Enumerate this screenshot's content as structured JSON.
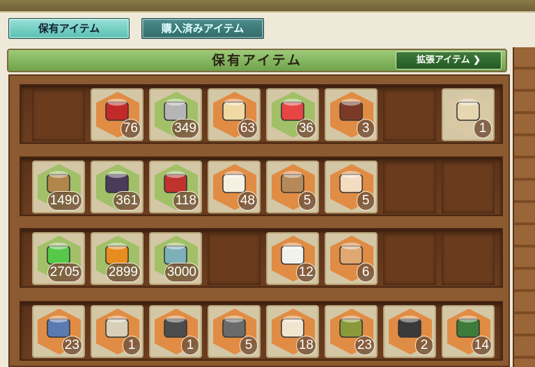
{
  "tabs": [
    {
      "label": "保有アイテム",
      "active": true
    },
    {
      "label": "購入済みアイテム",
      "active": false
    }
  ],
  "header": {
    "title": "保有アイテム",
    "expand_label": "拡張アイテム ❯"
  },
  "colors": {
    "hex_orange": "#e2853a",
    "hex_green": "#9bbf62",
    "hex_tan": "#d8c9a4"
  },
  "shelves": [
    {
      "slots": [
        null,
        {
          "icon": "red-box-medal-icon",
          "count": "76",
          "hex": "orange"
        },
        {
          "icon": "screw-icon",
          "count": "349",
          "hex": "green"
        },
        {
          "icon": "rice-ball-bento-icon",
          "count": "63",
          "hex": "orange"
        },
        {
          "icon": "present-box-icon",
          "count": "36",
          "hex": "green"
        },
        {
          "icon": "chocolate-box-icon",
          "count": "3",
          "hex": "orange"
        },
        null,
        {
          "icon": "map-blueprint-fairy-icon",
          "count": "1",
          "hex": "tan"
        }
      ]
    },
    {
      "slots": [
        {
          "icon": "furniture-box-small-icon",
          "count": "1490",
          "hex": "green"
        },
        {
          "icon": "furniture-box-medium-icon",
          "count": "361",
          "hex": "green"
        },
        {
          "icon": "furniture-box-large-icon",
          "count": "118",
          "hex": "green"
        },
        {
          "icon": "rice-bowl-icon",
          "count": "48",
          "hex": "orange"
        },
        {
          "icon": "wood-planks-icon",
          "count": "5",
          "hex": "orange"
        },
        {
          "icon": "headband-fairy-icon",
          "count": "5",
          "hex": "orange"
        },
        null,
        null
      ]
    },
    {
      "slots": [
        {
          "icon": "instant-repair-bucket-icon",
          "count": "2705",
          "hex": "green"
        },
        {
          "icon": "instant-construction-burner-icon",
          "count": "2899",
          "hex": "green"
        },
        {
          "icon": "development-material-gear-icon",
          "count": "3000",
          "hex": "green"
        },
        null,
        {
          "icon": "helmet-fairy-icon",
          "count": "12",
          "hex": "orange"
        },
        {
          "icon": "halo-fairy-icon",
          "count": "6",
          "hex": "orange"
        },
        null,
        null
      ]
    },
    {
      "slots": [
        {
          "icon": "aviator-fairy-icon",
          "count": "23",
          "hex": "orange"
        },
        {
          "icon": "fairies-with-rifle-icon",
          "count": "1",
          "hex": "orange"
        },
        {
          "icon": "armor-plate-icon",
          "count": "1",
          "hex": "orange"
        },
        {
          "icon": "fuel-can-icon",
          "count": "5",
          "hex": "orange"
        },
        {
          "icon": "bread-loaves-icon",
          "count": "18",
          "hex": "orange"
        },
        {
          "icon": "supply-sack-can-icon",
          "count": "23",
          "hex": "orange"
        },
        {
          "icon": "bulldozer-icon",
          "count": "2",
          "hex": "orange"
        },
        {
          "icon": "bolt-set-icon",
          "count": "14",
          "hex": "orange"
        }
      ]
    }
  ]
}
